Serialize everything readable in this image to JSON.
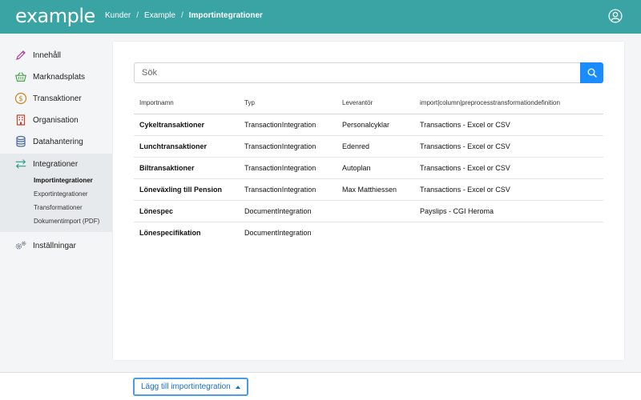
{
  "header": {
    "logo": "example",
    "breadcrumb": [
      "Kunder",
      "Example",
      "Importintegrationer"
    ],
    "breadcrumb_sep": "/"
  },
  "sidebar": {
    "items": [
      {
        "label": "Innehåll",
        "icon": "pencil-icon"
      },
      {
        "label": "Marknadsplats",
        "icon": "basket-icon"
      },
      {
        "label": "Transaktioner",
        "icon": "dollar-icon"
      },
      {
        "label": "Organisation",
        "icon": "building-icon"
      },
      {
        "label": "Datahantering",
        "icon": "database-icon"
      },
      {
        "label": "Integrationer",
        "icon": "arrows-exchange-icon"
      },
      {
        "label": "Inställningar",
        "icon": "gears-icon"
      }
    ],
    "sub_items": [
      "Importintegrationer",
      "Exportintegrationer",
      "Transformationer",
      "Dokumentimport (PDF)"
    ]
  },
  "search": {
    "placeholder": "Sök",
    "value": ""
  },
  "table": {
    "headers": [
      "Importnamn",
      "Typ",
      "Leverantör",
      "import|column|preprocesstransformationdefinition"
    ],
    "rows": [
      [
        "Cykeltransaktioner",
        "TransactionIntegration",
        "Personalcyklar",
        "Transactions - Excel or CSV"
      ],
      [
        "Lunchtransaktioner",
        "TransactionIntegration",
        "Edenred",
        "Transactions - Excel or CSV"
      ],
      [
        "Biltransaktioner",
        "TransactionIntegration",
        "Autoplan",
        "Transactions - Excel or CSV"
      ],
      [
        "Löneväxling till Pension",
        "TransactionIntegration",
        "Max Matthiessen",
        "Transactions - Excel or CSV"
      ],
      [
        "Lönespec",
        "DocumentIntegration",
        "",
        "Payslips - CGI Heroma"
      ],
      [
        "Lönespecifikation",
        "DocumentIntegration",
        "",
        ""
      ]
    ]
  },
  "footer": {
    "add_button": "Lägg till importintegration"
  },
  "colors": {
    "header": "#3aa3a3",
    "primary": "#1a8cff",
    "accent_border": "#4a9ce8"
  }
}
